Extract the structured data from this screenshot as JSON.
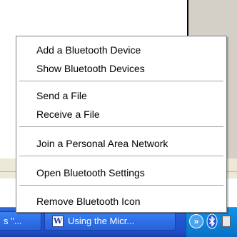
{
  "menu": {
    "items": [
      {
        "label": "Add a Bluetooth Device"
      },
      {
        "label": "Show Bluetooth Devices"
      },
      {
        "label": "Send a File"
      },
      {
        "label": "Receive a File"
      },
      {
        "label": "Join a Personal Area Network"
      },
      {
        "label": "Open Bluetooth Settings"
      },
      {
        "label": "Remove Bluetooth Icon"
      }
    ]
  },
  "taskbar": {
    "left_button_label": "s \"...",
    "word_button_label": "Using the Micr...",
    "word_icon_glyph": "W",
    "tray_arrow_glyph": "»",
    "icons": [
      "word-document-icon",
      "chevron-icon",
      "bluetooth-icon"
    ]
  },
  "colors": {
    "taskbar": "#2456d0",
    "tray": "#0d83d9",
    "menu_background": "#ffffff",
    "separator": "#a5a5a5"
  }
}
